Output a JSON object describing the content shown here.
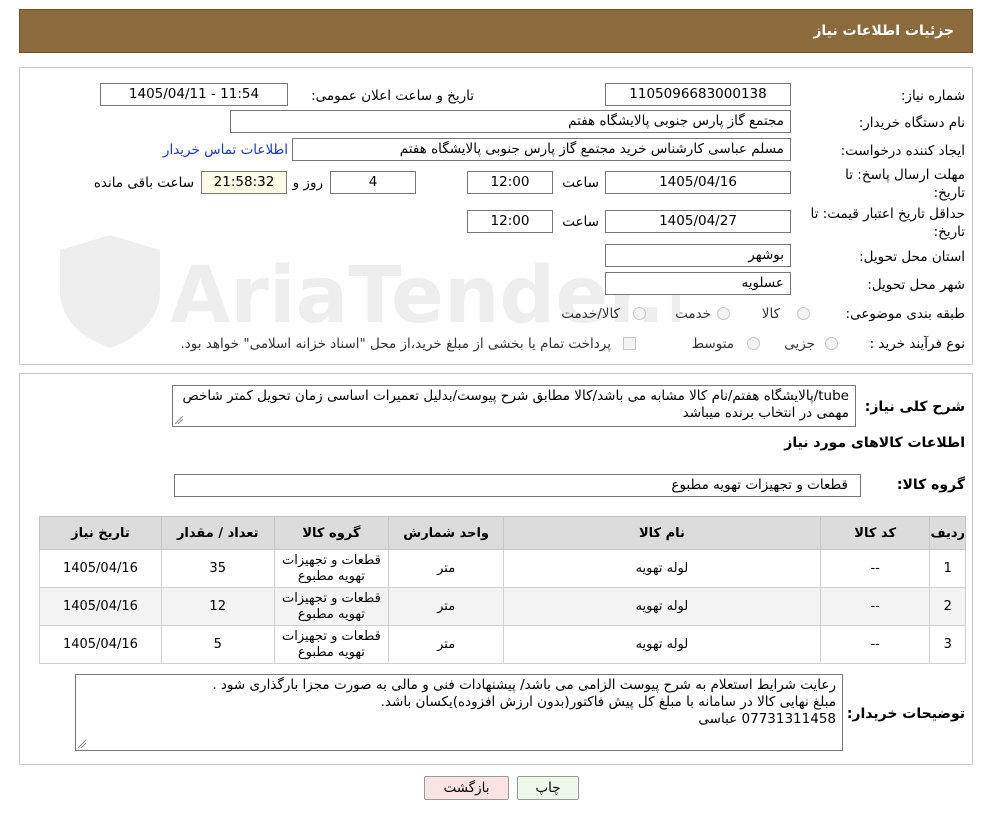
{
  "header": {
    "title": "جزئیات اطلاعات نیاز"
  },
  "form": {
    "need_number": {
      "label": "شماره نیاز:",
      "value": "1105096683000138"
    },
    "announce_datetime": {
      "label": "تاریخ و ساعت اعلان عمومی:",
      "value": "1405/04/11 - 11:54"
    },
    "buyer_org": {
      "label": "نام دستگاه خریدار:",
      "value": "مجتمع گاز پارس جنوبی  پالایشگاه هفتم"
    },
    "requester": {
      "label": "ایجاد کننده درخواست:",
      "value": "مسلم عباسی کارشناس خرید مجتمع گاز پارس جنوبی  پالایشگاه هفتم",
      "contact_link": "اطلاعات تماس خریدار"
    },
    "reply_deadline": {
      "label": "مهلت ارسال پاسخ: تا تاریخ:",
      "date": "1405/04/16",
      "time_label": "ساعت",
      "time": "12:00",
      "days": "4",
      "days_label": "روز و",
      "remaining": "21:58:32",
      "remaining_label": "ساعت باقی مانده"
    },
    "price_validity": {
      "label": "حداقل تاریخ اعتبار قیمت: تا تاریخ:",
      "date": "1405/04/27",
      "time_label": "ساعت",
      "time": "12:00"
    },
    "province": {
      "label": "استان محل تحویل:",
      "value": "بوشهر"
    },
    "city": {
      "label": "شهر محل تحویل:",
      "value": "عسلویه"
    },
    "category": {
      "label": "طبقه بندی موضوعی:",
      "options": [
        "کالا",
        "خدمت",
        "کالا/خدمت"
      ]
    },
    "process_type": {
      "label": "نوع فرآیند خرید :",
      "options": [
        "جزیی",
        "متوسط"
      ],
      "note": "پرداخت تمام یا بخشی از مبلغ خرید،از محل \"اسناد خزانه اسلامی\" خواهد بود."
    }
  },
  "summary": {
    "label": "شرح کلی نیاز:",
    "text": "tube/پالایشگاه هفتم/نام کالا مشابه می باشد/کالا مطابق شرح پیوست/بدلیل تعمیرات اساسی زمان تحویل کمتر شاخص مهمی در انتخاب برنده میباشد"
  },
  "goods_info": {
    "title": "اطلاعات کالاهای مورد نیاز"
  },
  "goods_group": {
    "label": "گروه کالا:",
    "value": "قطعات و تجهیزات تهویه مطبوع"
  },
  "table": {
    "headers": [
      "ردیف",
      "کد کالا",
      "نام کالا",
      "واحد شمارش",
      "گروه کالا",
      "تعداد / مقدار",
      "تاریخ نیاز"
    ],
    "rows": [
      [
        "1",
        "--",
        "لوله تهویه",
        "متر",
        "قطعات و تجهیزات تهویه مطبوع",
        "35",
        "1405/04/16"
      ],
      [
        "2",
        "--",
        "لوله تهویه",
        "متر",
        "قطعات و تجهیزات تهویه مطبوع",
        "12",
        "1405/04/16"
      ],
      [
        "3",
        "--",
        "لوله تهویه",
        "متر",
        "قطعات و تجهیزات تهویه مطبوع",
        "5",
        "1405/04/16"
      ]
    ]
  },
  "buyer_notes": {
    "label": "توضیحات خریدار:",
    "lines": [
      "رعایت شرایط استعلام به شرح پیوست الزامی می باشد/ پیشنهادات فنی و مالی به صورت مجزا بارگذاری شود .",
      "مبلغ نهایی کالا در سامانه با مبلغ کل پیش فاکتور(بدون ارزش افزوده)یکسان باشد.",
      "07731311458  عباسی"
    ]
  },
  "buttons": {
    "print": "چاپ",
    "back": "بازگشت"
  },
  "watermark": {
    "text": "AriaTender.neT"
  }
}
